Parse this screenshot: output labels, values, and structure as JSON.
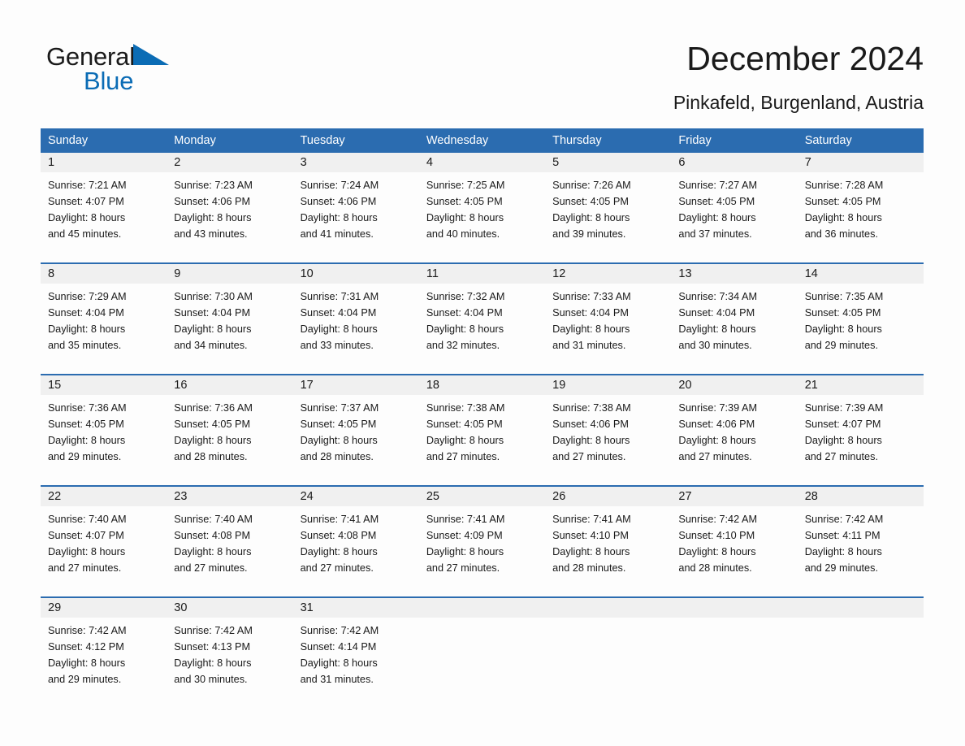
{
  "brand": {
    "name_part1": "General",
    "name_part2": "Blue",
    "triangle_color": "#0b6cb5",
    "text_color": "#1a1a1a"
  },
  "header": {
    "title": "December 2024",
    "subtitle": "Pinkafeld, Burgenland, Austria"
  },
  "theme": {
    "header_blue": "#2b6cb0",
    "daynum_gray": "#f0f0f0",
    "page_background": "#fdfdfd"
  },
  "weekday_headers": [
    "Sunday",
    "Monday",
    "Tuesday",
    "Wednesday",
    "Thursday",
    "Friday",
    "Saturday"
  ],
  "weeks": [
    [
      {
        "day": "1",
        "sunrise": "Sunrise: 7:21 AM",
        "sunset": "Sunset: 4:07 PM",
        "daylight1": "Daylight: 8 hours",
        "daylight2": "and 45 minutes."
      },
      {
        "day": "2",
        "sunrise": "Sunrise: 7:23 AM",
        "sunset": "Sunset: 4:06 PM",
        "daylight1": "Daylight: 8 hours",
        "daylight2": "and 43 minutes."
      },
      {
        "day": "3",
        "sunrise": "Sunrise: 7:24 AM",
        "sunset": "Sunset: 4:06 PM",
        "daylight1": "Daylight: 8 hours",
        "daylight2": "and 41 minutes."
      },
      {
        "day": "4",
        "sunrise": "Sunrise: 7:25 AM",
        "sunset": "Sunset: 4:05 PM",
        "daylight1": "Daylight: 8 hours",
        "daylight2": "and 40 minutes."
      },
      {
        "day": "5",
        "sunrise": "Sunrise: 7:26 AM",
        "sunset": "Sunset: 4:05 PM",
        "daylight1": "Daylight: 8 hours",
        "daylight2": "and 39 minutes."
      },
      {
        "day": "6",
        "sunrise": "Sunrise: 7:27 AM",
        "sunset": "Sunset: 4:05 PM",
        "daylight1": "Daylight: 8 hours",
        "daylight2": "and 37 minutes."
      },
      {
        "day": "7",
        "sunrise": "Sunrise: 7:28 AM",
        "sunset": "Sunset: 4:05 PM",
        "daylight1": "Daylight: 8 hours",
        "daylight2": "and 36 minutes."
      }
    ],
    [
      {
        "day": "8",
        "sunrise": "Sunrise: 7:29 AM",
        "sunset": "Sunset: 4:04 PM",
        "daylight1": "Daylight: 8 hours",
        "daylight2": "and 35 minutes."
      },
      {
        "day": "9",
        "sunrise": "Sunrise: 7:30 AM",
        "sunset": "Sunset: 4:04 PM",
        "daylight1": "Daylight: 8 hours",
        "daylight2": "and 34 minutes."
      },
      {
        "day": "10",
        "sunrise": "Sunrise: 7:31 AM",
        "sunset": "Sunset: 4:04 PM",
        "daylight1": "Daylight: 8 hours",
        "daylight2": "and 33 minutes."
      },
      {
        "day": "11",
        "sunrise": "Sunrise: 7:32 AM",
        "sunset": "Sunset: 4:04 PM",
        "daylight1": "Daylight: 8 hours",
        "daylight2": "and 32 minutes."
      },
      {
        "day": "12",
        "sunrise": "Sunrise: 7:33 AM",
        "sunset": "Sunset: 4:04 PM",
        "daylight1": "Daylight: 8 hours",
        "daylight2": "and 31 minutes."
      },
      {
        "day": "13",
        "sunrise": "Sunrise: 7:34 AM",
        "sunset": "Sunset: 4:04 PM",
        "daylight1": "Daylight: 8 hours",
        "daylight2": "and 30 minutes."
      },
      {
        "day": "14",
        "sunrise": "Sunrise: 7:35 AM",
        "sunset": "Sunset: 4:05 PM",
        "daylight1": "Daylight: 8 hours",
        "daylight2": "and 29 minutes."
      }
    ],
    [
      {
        "day": "15",
        "sunrise": "Sunrise: 7:36 AM",
        "sunset": "Sunset: 4:05 PM",
        "daylight1": "Daylight: 8 hours",
        "daylight2": "and 29 minutes."
      },
      {
        "day": "16",
        "sunrise": "Sunrise: 7:36 AM",
        "sunset": "Sunset: 4:05 PM",
        "daylight1": "Daylight: 8 hours",
        "daylight2": "and 28 minutes."
      },
      {
        "day": "17",
        "sunrise": "Sunrise: 7:37 AM",
        "sunset": "Sunset: 4:05 PM",
        "daylight1": "Daylight: 8 hours",
        "daylight2": "and 28 minutes."
      },
      {
        "day": "18",
        "sunrise": "Sunrise: 7:38 AM",
        "sunset": "Sunset: 4:05 PM",
        "daylight1": "Daylight: 8 hours",
        "daylight2": "and 27 minutes."
      },
      {
        "day": "19",
        "sunrise": "Sunrise: 7:38 AM",
        "sunset": "Sunset: 4:06 PM",
        "daylight1": "Daylight: 8 hours",
        "daylight2": "and 27 minutes."
      },
      {
        "day": "20",
        "sunrise": "Sunrise: 7:39 AM",
        "sunset": "Sunset: 4:06 PM",
        "daylight1": "Daylight: 8 hours",
        "daylight2": "and 27 minutes."
      },
      {
        "day": "21",
        "sunrise": "Sunrise: 7:39 AM",
        "sunset": "Sunset: 4:07 PM",
        "daylight1": "Daylight: 8 hours",
        "daylight2": "and 27 minutes."
      }
    ],
    [
      {
        "day": "22",
        "sunrise": "Sunrise: 7:40 AM",
        "sunset": "Sunset: 4:07 PM",
        "daylight1": "Daylight: 8 hours",
        "daylight2": "and 27 minutes."
      },
      {
        "day": "23",
        "sunrise": "Sunrise: 7:40 AM",
        "sunset": "Sunset: 4:08 PM",
        "daylight1": "Daylight: 8 hours",
        "daylight2": "and 27 minutes."
      },
      {
        "day": "24",
        "sunrise": "Sunrise: 7:41 AM",
        "sunset": "Sunset: 4:08 PM",
        "daylight1": "Daylight: 8 hours",
        "daylight2": "and 27 minutes."
      },
      {
        "day": "25",
        "sunrise": "Sunrise: 7:41 AM",
        "sunset": "Sunset: 4:09 PM",
        "daylight1": "Daylight: 8 hours",
        "daylight2": "and 27 minutes."
      },
      {
        "day": "26",
        "sunrise": "Sunrise: 7:41 AM",
        "sunset": "Sunset: 4:10 PM",
        "daylight1": "Daylight: 8 hours",
        "daylight2": "and 28 minutes."
      },
      {
        "day": "27",
        "sunrise": "Sunrise: 7:42 AM",
        "sunset": "Sunset: 4:10 PM",
        "daylight1": "Daylight: 8 hours",
        "daylight2": "and 28 minutes."
      },
      {
        "day": "28",
        "sunrise": "Sunrise: 7:42 AM",
        "sunset": "Sunset: 4:11 PM",
        "daylight1": "Daylight: 8 hours",
        "daylight2": "and 29 minutes."
      }
    ],
    [
      {
        "day": "29",
        "sunrise": "Sunrise: 7:42 AM",
        "sunset": "Sunset: 4:12 PM",
        "daylight1": "Daylight: 8 hours",
        "daylight2": "and 29 minutes."
      },
      {
        "day": "30",
        "sunrise": "Sunrise: 7:42 AM",
        "sunset": "Sunset: 4:13 PM",
        "daylight1": "Daylight: 8 hours",
        "daylight2": "and 30 minutes."
      },
      {
        "day": "31",
        "sunrise": "Sunrise: 7:42 AM",
        "sunset": "Sunset: 4:14 PM",
        "daylight1": "Daylight: 8 hours",
        "daylight2": "and 31 minutes."
      },
      {
        "day": "",
        "sunrise": "",
        "sunset": "",
        "daylight1": "",
        "daylight2": ""
      },
      {
        "day": "",
        "sunrise": "",
        "sunset": "",
        "daylight1": "",
        "daylight2": ""
      },
      {
        "day": "",
        "sunrise": "",
        "sunset": "",
        "daylight1": "",
        "daylight2": ""
      },
      {
        "day": "",
        "sunrise": "",
        "sunset": "",
        "daylight1": "",
        "daylight2": ""
      }
    ]
  ]
}
